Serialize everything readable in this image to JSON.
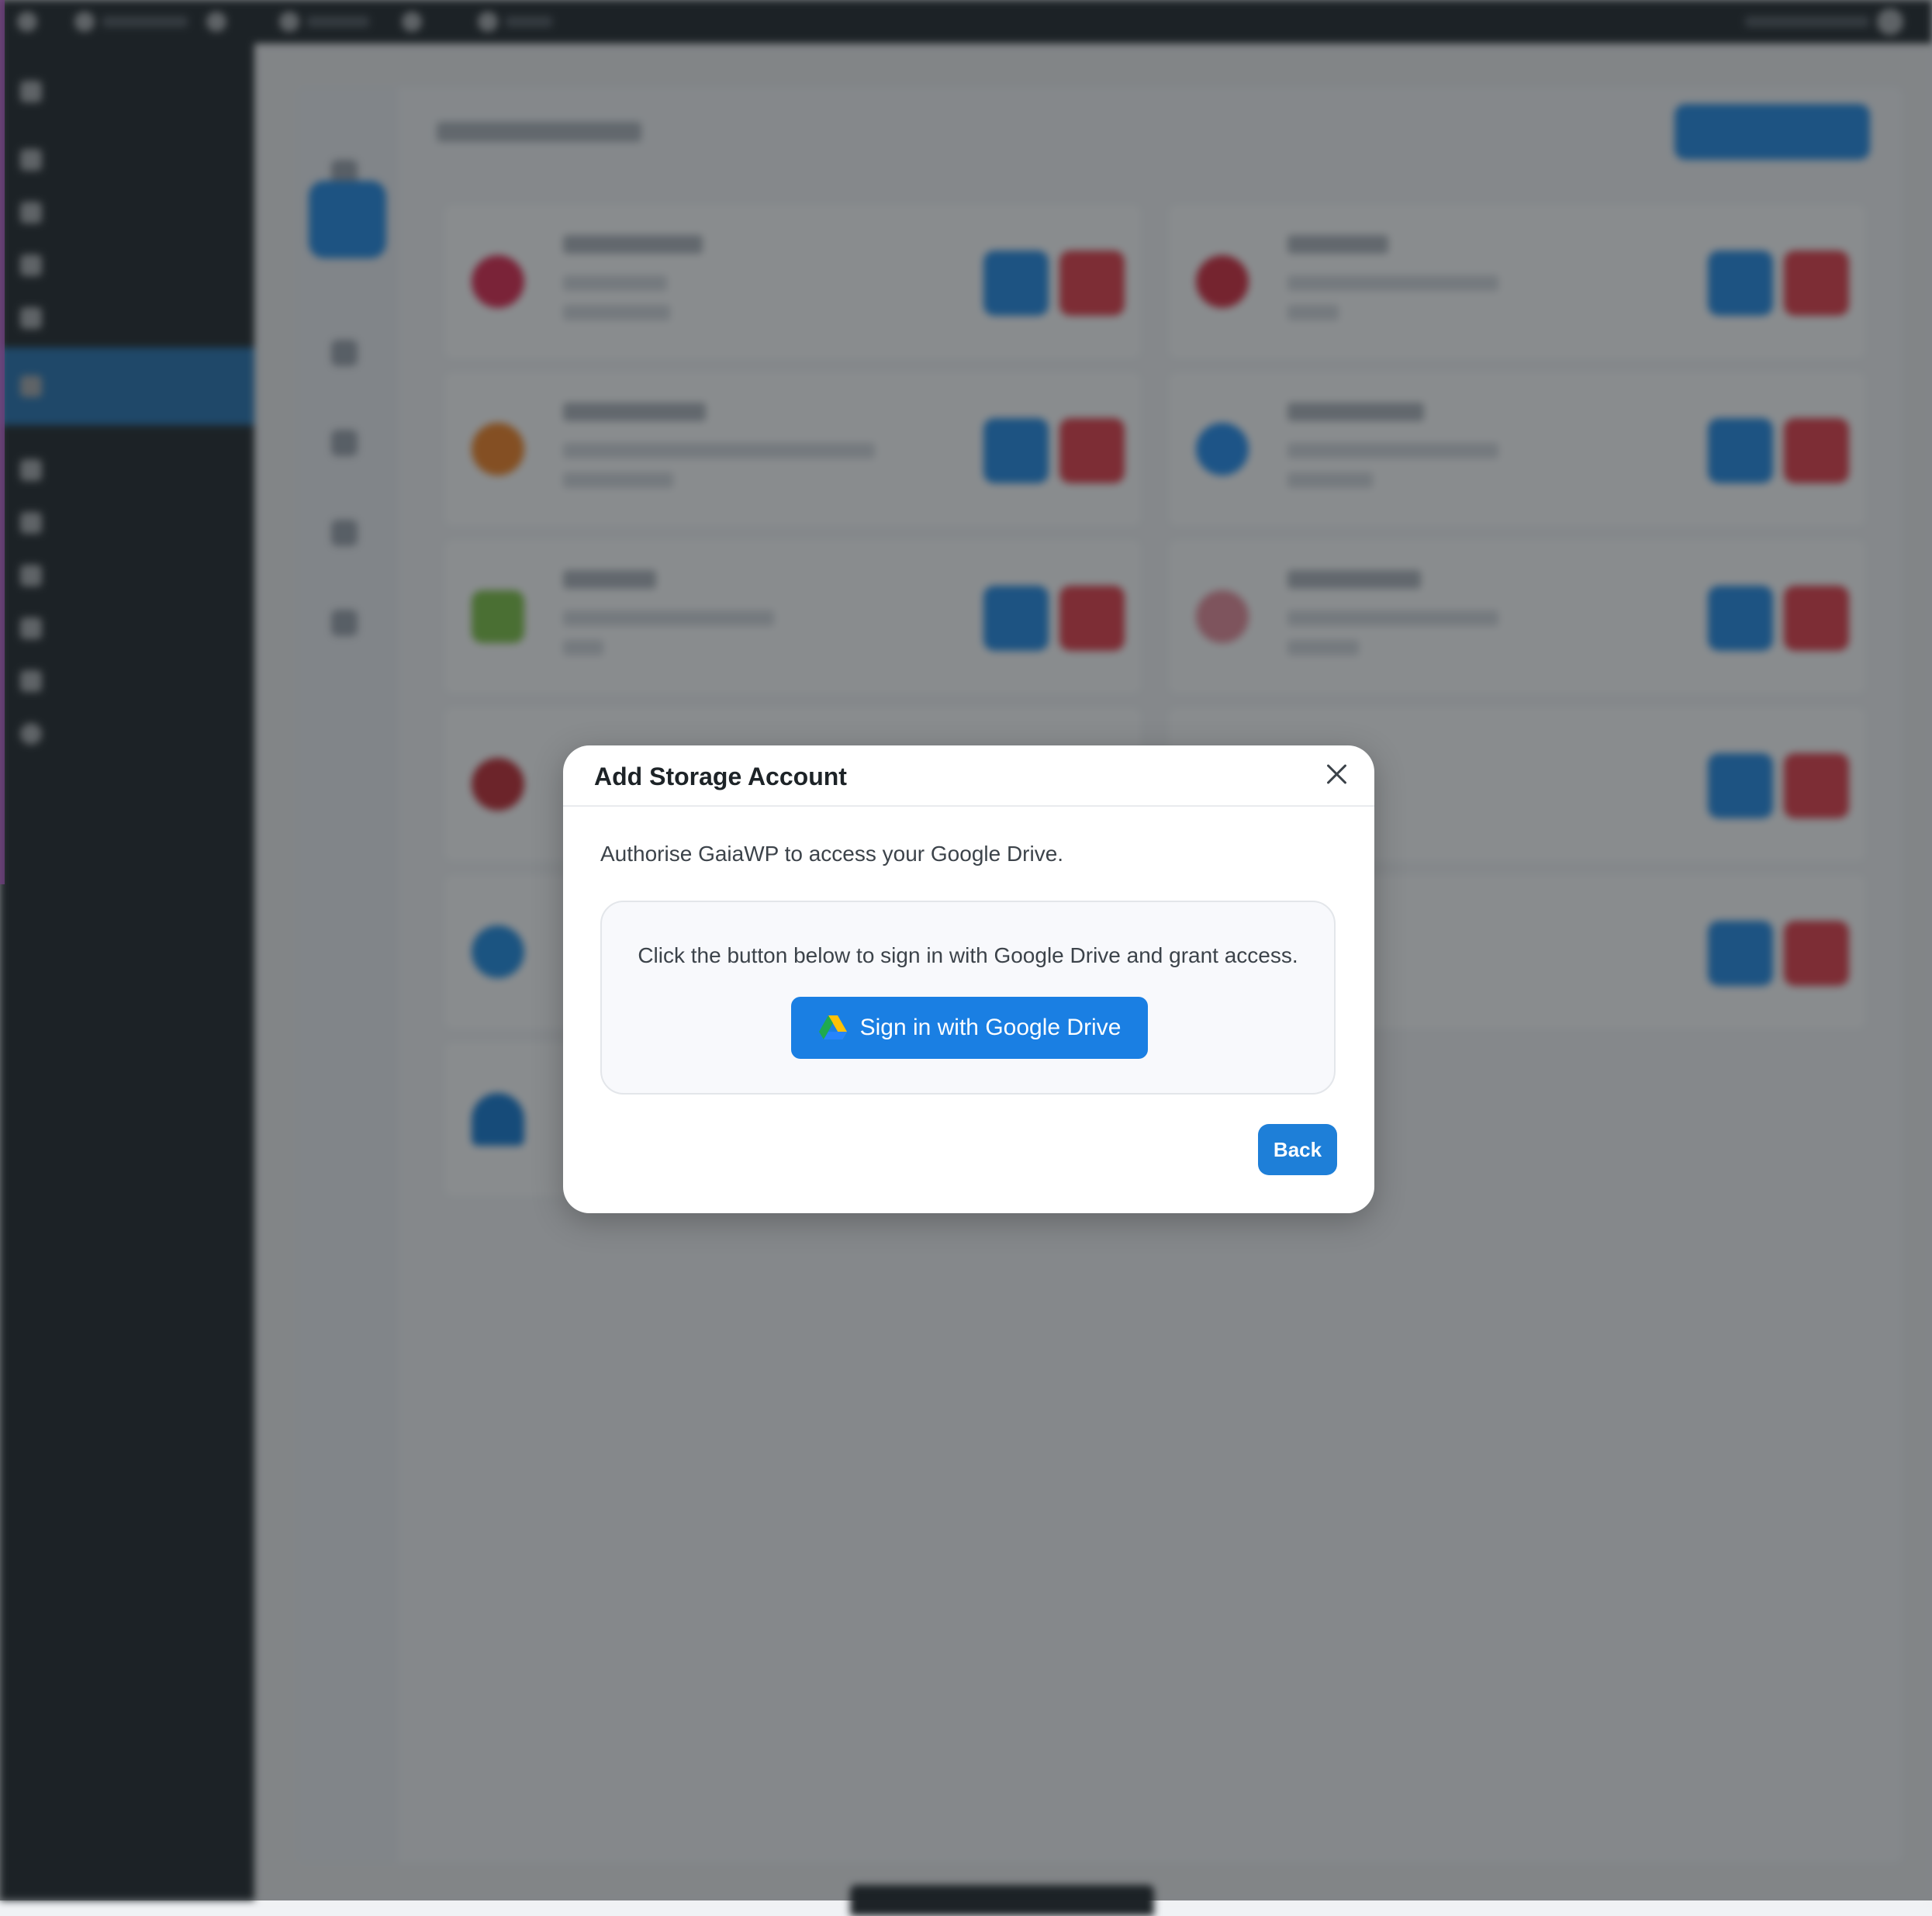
{
  "modal": {
    "title": "Add Storage Account",
    "description": "Authorise GaiaWP to access your Google Drive.",
    "instruction": "Click the button below to sign in with Google Drive and grant access.",
    "signin_label": "Sign in with Google Drive",
    "back_label": "Back",
    "close_icon": "close-icon",
    "signin_icon": "google-drive-icon"
  },
  "colors": {
    "accent": "#1a7fe3",
    "danger": "#e53945",
    "admin_dark": "#1d2327"
  }
}
